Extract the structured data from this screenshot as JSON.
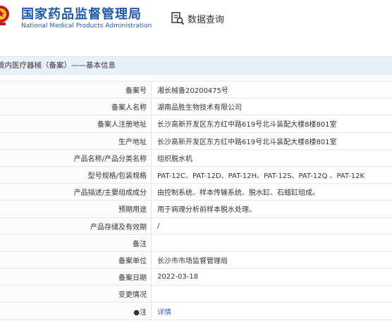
{
  "header": {
    "title_cn": "国家药品监督管理局",
    "title_en": "National Medical Products Administration",
    "query_label": "数据查询"
  },
  "section": {
    "title": "境内医疗器械（备案）——基本信息"
  },
  "rows": [
    {
      "label": "备案号",
      "value": "湘长械备20200475号"
    },
    {
      "label": "备案人名称",
      "value": "湖南品胜生物技术有限公司"
    },
    {
      "label": "备案人注册地址",
      "value": "长沙高新开发区东方红中路619号北斗装配大楼8楼801室"
    },
    {
      "label": "生产地址",
      "value": "长沙高新开发区东方红中路619号北斗装配大楼8楼801室"
    },
    {
      "label": "产品名称/产品分类名称",
      "value": "组织脱水机"
    },
    {
      "label": "型号规格/包装规格",
      "value": "PAT-12C、PAT-12D、PAT-12H、PAT-12S、PAT-12Q 、PAT-12K"
    },
    {
      "label": "产品描述/主要组成成分",
      "value": "由控制系统、样本传输系统、脱水缸、石蜡缸组成。"
    },
    {
      "label": "预期用途",
      "value": "用于病理分析前样本脱水处理。"
    },
    {
      "label": "产品存储及有效期",
      "value": "/"
    },
    {
      "label": "备注",
      "value": ""
    },
    {
      "label": "备案单位",
      "value": "长沙市市场监督管理局"
    },
    {
      "label": "备案日期",
      "value": "2022-03-18"
    },
    {
      "label": "变更情况",
      "value": ""
    },
    {
      "label": "●注",
      "value": "详情"
    }
  ],
  "colors": {
    "brand": "#1f5aa8",
    "link": "#2a66c4",
    "section_bg": "#e8f0f8",
    "emblem": "#c8161d"
  },
  "icons": {
    "emblem": "national-emblem-icon",
    "query": "search-document-icon"
  }
}
